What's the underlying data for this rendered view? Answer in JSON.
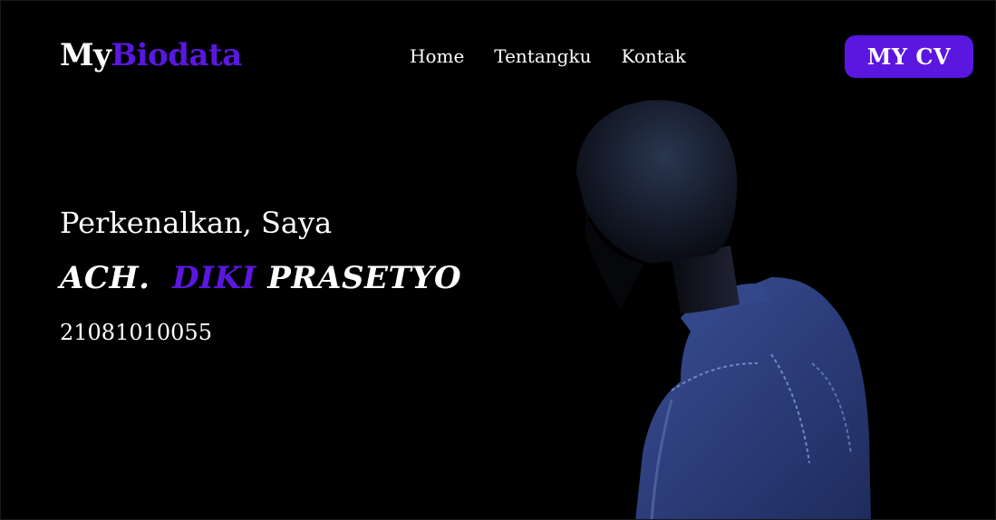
{
  "header": {
    "logo_part1": "My",
    "logo_part2": "Biodata",
    "nav": [
      {
        "label": "Home"
      },
      {
        "label": "Tentangku"
      },
      {
        "label": "Kontak"
      }
    ],
    "cv_button_label": "MY CV"
  },
  "hero": {
    "intro": "Perkenalkan, Saya",
    "name_part1": "ACH.",
    "name_part2": "DIKI",
    "name_part3": "PRASETYO",
    "id_number": "21081010055"
  },
  "colors": {
    "background": "#000000",
    "accent": "#5a17e0",
    "text": "#ffffff"
  }
}
